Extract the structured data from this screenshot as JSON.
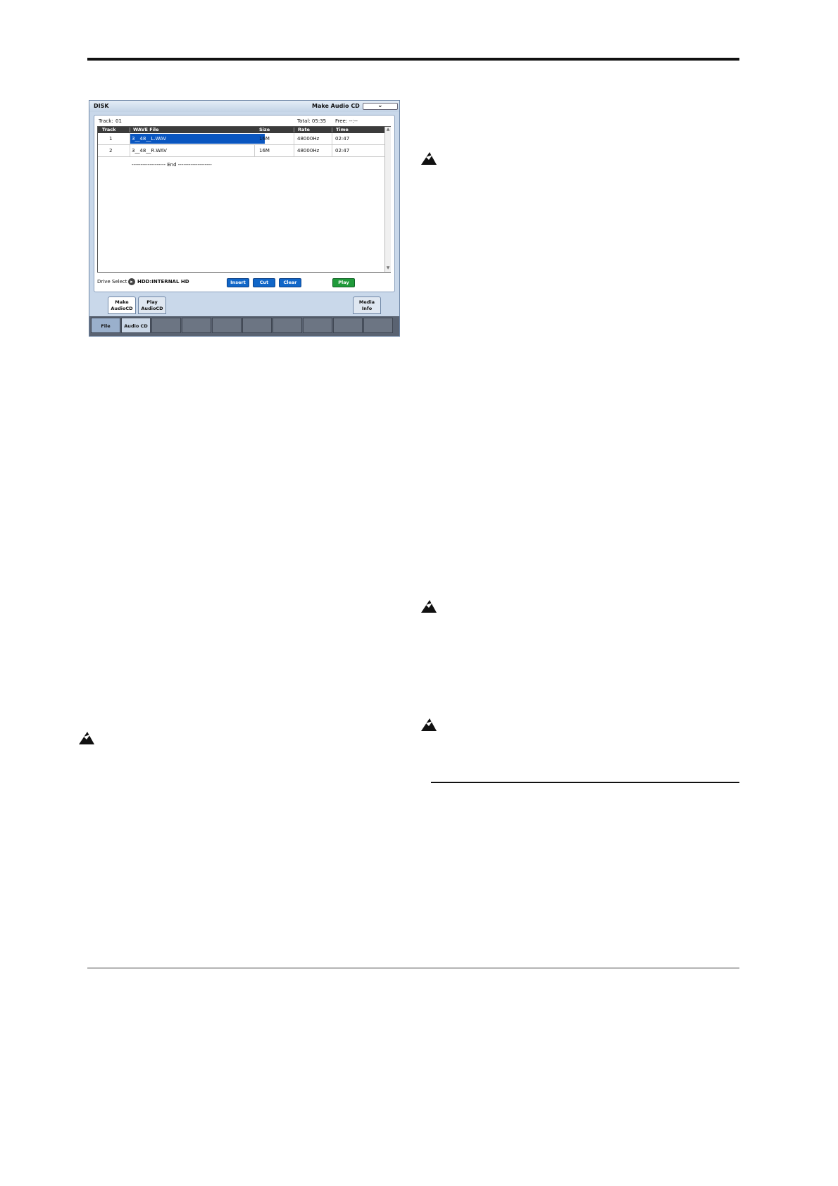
{
  "screen": {
    "title": "DISK",
    "page_name": "Make Audio CD",
    "menu_icon": "chevron-down-icon",
    "track_label": "Track:",
    "track_value": "01",
    "total": "Total: 05:35",
    "free": "Free: --:--",
    "table": {
      "headers": [
        "Track",
        "WAVE File",
        "Size",
        "Rate",
        "Time"
      ],
      "rows": [
        {
          "track": "1",
          "file": "3__48__L.WAV",
          "size": "16M",
          "rate": "48000Hz",
          "time": "02:47"
        },
        {
          "track": "2",
          "file": "3__48__R.WAV",
          "size": "16M",
          "rate": "48000Hz",
          "time": "02:47"
        }
      ],
      "end_marker": "------------------- End -------------------"
    },
    "drive_select_label": "Drive Select",
    "drive_select_value": "HDD:INTERNAL HD",
    "buttons": {
      "insert": "Insert",
      "cut": "Cut",
      "clear": "Clear",
      "play": "Play"
    },
    "subtabs": {
      "make_1": "Make",
      "make_2": "AudioCD",
      "play_1": "Play",
      "play_2": "AudioCD",
      "media_1": "Media",
      "media_2": "Info"
    },
    "tabs": {
      "file": "File",
      "audio_cd": "Audio CD"
    }
  }
}
